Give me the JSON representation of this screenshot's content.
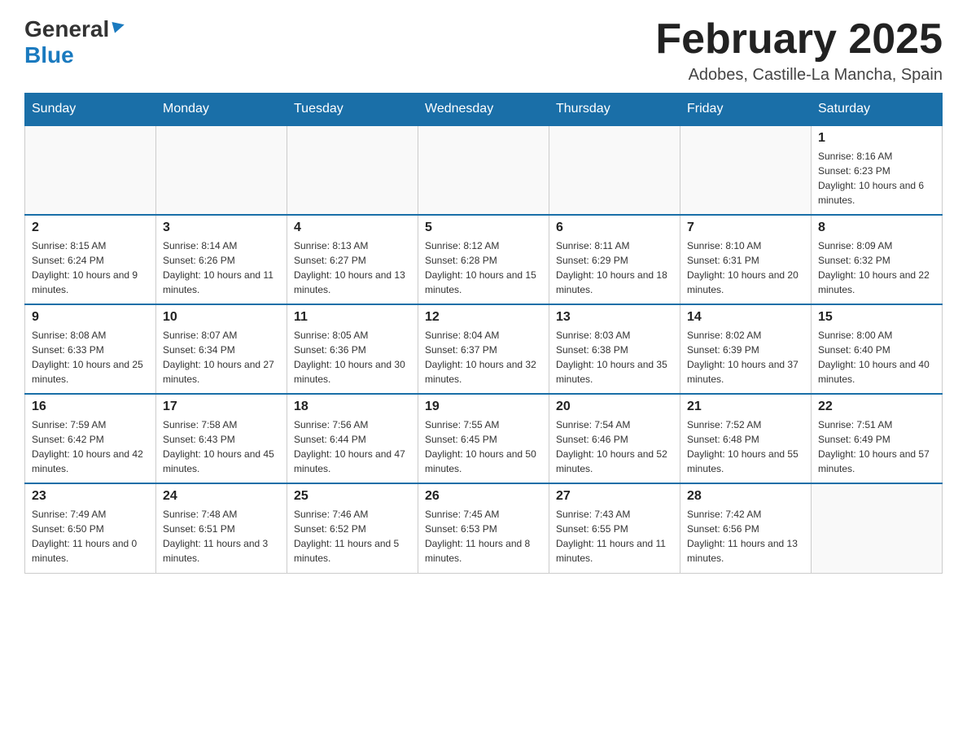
{
  "header": {
    "logo_general": "General",
    "logo_blue": "Blue",
    "title": "February 2025",
    "location": "Adobes, Castille-La Mancha, Spain"
  },
  "weekdays": [
    "Sunday",
    "Monday",
    "Tuesday",
    "Wednesday",
    "Thursday",
    "Friday",
    "Saturday"
  ],
  "weeks": [
    [
      {
        "day": "",
        "info": ""
      },
      {
        "day": "",
        "info": ""
      },
      {
        "day": "",
        "info": ""
      },
      {
        "day": "",
        "info": ""
      },
      {
        "day": "",
        "info": ""
      },
      {
        "day": "",
        "info": ""
      },
      {
        "day": "1",
        "info": "Sunrise: 8:16 AM\nSunset: 6:23 PM\nDaylight: 10 hours and 6 minutes."
      }
    ],
    [
      {
        "day": "2",
        "info": "Sunrise: 8:15 AM\nSunset: 6:24 PM\nDaylight: 10 hours and 9 minutes."
      },
      {
        "day": "3",
        "info": "Sunrise: 8:14 AM\nSunset: 6:26 PM\nDaylight: 10 hours and 11 minutes."
      },
      {
        "day": "4",
        "info": "Sunrise: 8:13 AM\nSunset: 6:27 PM\nDaylight: 10 hours and 13 minutes."
      },
      {
        "day": "5",
        "info": "Sunrise: 8:12 AM\nSunset: 6:28 PM\nDaylight: 10 hours and 15 minutes."
      },
      {
        "day": "6",
        "info": "Sunrise: 8:11 AM\nSunset: 6:29 PM\nDaylight: 10 hours and 18 minutes."
      },
      {
        "day": "7",
        "info": "Sunrise: 8:10 AM\nSunset: 6:31 PM\nDaylight: 10 hours and 20 minutes."
      },
      {
        "day": "8",
        "info": "Sunrise: 8:09 AM\nSunset: 6:32 PM\nDaylight: 10 hours and 22 minutes."
      }
    ],
    [
      {
        "day": "9",
        "info": "Sunrise: 8:08 AM\nSunset: 6:33 PM\nDaylight: 10 hours and 25 minutes."
      },
      {
        "day": "10",
        "info": "Sunrise: 8:07 AM\nSunset: 6:34 PM\nDaylight: 10 hours and 27 minutes."
      },
      {
        "day": "11",
        "info": "Sunrise: 8:05 AM\nSunset: 6:36 PM\nDaylight: 10 hours and 30 minutes."
      },
      {
        "day": "12",
        "info": "Sunrise: 8:04 AM\nSunset: 6:37 PM\nDaylight: 10 hours and 32 minutes."
      },
      {
        "day": "13",
        "info": "Sunrise: 8:03 AM\nSunset: 6:38 PM\nDaylight: 10 hours and 35 minutes."
      },
      {
        "day": "14",
        "info": "Sunrise: 8:02 AM\nSunset: 6:39 PM\nDaylight: 10 hours and 37 minutes."
      },
      {
        "day": "15",
        "info": "Sunrise: 8:00 AM\nSunset: 6:40 PM\nDaylight: 10 hours and 40 minutes."
      }
    ],
    [
      {
        "day": "16",
        "info": "Sunrise: 7:59 AM\nSunset: 6:42 PM\nDaylight: 10 hours and 42 minutes."
      },
      {
        "day": "17",
        "info": "Sunrise: 7:58 AM\nSunset: 6:43 PM\nDaylight: 10 hours and 45 minutes."
      },
      {
        "day": "18",
        "info": "Sunrise: 7:56 AM\nSunset: 6:44 PM\nDaylight: 10 hours and 47 minutes."
      },
      {
        "day": "19",
        "info": "Sunrise: 7:55 AM\nSunset: 6:45 PM\nDaylight: 10 hours and 50 minutes."
      },
      {
        "day": "20",
        "info": "Sunrise: 7:54 AM\nSunset: 6:46 PM\nDaylight: 10 hours and 52 minutes."
      },
      {
        "day": "21",
        "info": "Sunrise: 7:52 AM\nSunset: 6:48 PM\nDaylight: 10 hours and 55 minutes."
      },
      {
        "day": "22",
        "info": "Sunrise: 7:51 AM\nSunset: 6:49 PM\nDaylight: 10 hours and 57 minutes."
      }
    ],
    [
      {
        "day": "23",
        "info": "Sunrise: 7:49 AM\nSunset: 6:50 PM\nDaylight: 11 hours and 0 minutes."
      },
      {
        "day": "24",
        "info": "Sunrise: 7:48 AM\nSunset: 6:51 PM\nDaylight: 11 hours and 3 minutes."
      },
      {
        "day": "25",
        "info": "Sunrise: 7:46 AM\nSunset: 6:52 PM\nDaylight: 11 hours and 5 minutes."
      },
      {
        "day": "26",
        "info": "Sunrise: 7:45 AM\nSunset: 6:53 PM\nDaylight: 11 hours and 8 minutes."
      },
      {
        "day": "27",
        "info": "Sunrise: 7:43 AM\nSunset: 6:55 PM\nDaylight: 11 hours and 11 minutes."
      },
      {
        "day": "28",
        "info": "Sunrise: 7:42 AM\nSunset: 6:56 PM\nDaylight: 11 hours and 13 minutes."
      },
      {
        "day": "",
        "info": ""
      }
    ]
  ]
}
